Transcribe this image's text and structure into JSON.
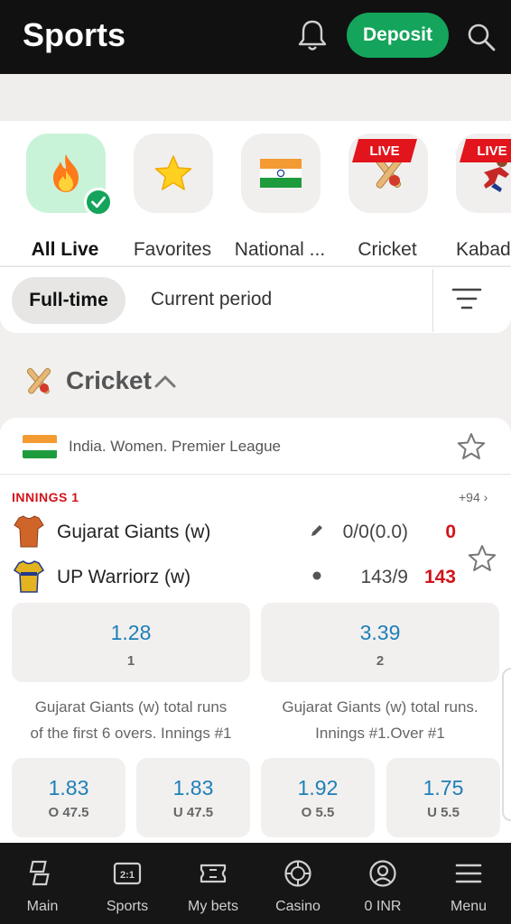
{
  "topbar": {
    "title": "Sports",
    "deposit_label": "Deposit"
  },
  "categories": [
    {
      "label": "All Live",
      "icon": "fire-icon",
      "active": true
    },
    {
      "label": "Favorites",
      "icon": "star-icon"
    },
    {
      "label": "National ...",
      "icon": "india-flag-icon"
    },
    {
      "label": "Cricket",
      "icon": "cricket-icon",
      "badge": "LIVE"
    },
    {
      "label": "Kabad",
      "icon": "kabaddi-icon",
      "badge": "LIVE"
    }
  ],
  "period": {
    "full_time": "Full-time",
    "current": "Current period"
  },
  "section": {
    "title": "Cricket"
  },
  "match": {
    "league": "India. Women. Premier League",
    "status": "INNINGS 1",
    "more": "+94 ›",
    "teams": [
      {
        "name": "Gujarat Giants (w)",
        "score": "0/0(0.0)",
        "total": "0",
        "jersey_color": "#d0652a"
      },
      {
        "name": "UP Warriorz (w)",
        "score": "143/9",
        "total": "143",
        "jersey_color": "#e3b320"
      }
    ],
    "main_odds": [
      {
        "value": "1.28",
        "key": "1"
      },
      {
        "value": "3.39",
        "key": "2"
      }
    ],
    "markets": [
      {
        "line1": "Gujarat Giants (w) total runs",
        "line2": "of the first 6 overs. Innings #1"
      },
      {
        "line1": "Gujarat Giants (w) total runs.",
        "line2": "Innings #1.Over #1"
      }
    ],
    "sub_odds": [
      {
        "value": "1.83",
        "key": "O 47.5"
      },
      {
        "value": "1.83",
        "key": "U 47.5"
      },
      {
        "value": "1.92",
        "key": "O 5.5"
      },
      {
        "value": "1.75",
        "key": "U 5.5"
      }
    ]
  },
  "bottom_nav": [
    {
      "label": "Main",
      "icon": "main-icon"
    },
    {
      "label": "Sports",
      "icon": "scoreboard-icon"
    },
    {
      "label": "My bets",
      "icon": "ticket-icon"
    },
    {
      "label": "Casino",
      "icon": "casino-chip-icon"
    },
    {
      "label": "0 INR",
      "icon": "account-icon"
    },
    {
      "label": "Menu",
      "icon": "menu-icon"
    }
  ],
  "colors": {
    "accent_green": "#14a45b",
    "live_red": "#e2141c",
    "odds_blue": "#1e7fb8",
    "header_bg": "#111111"
  }
}
